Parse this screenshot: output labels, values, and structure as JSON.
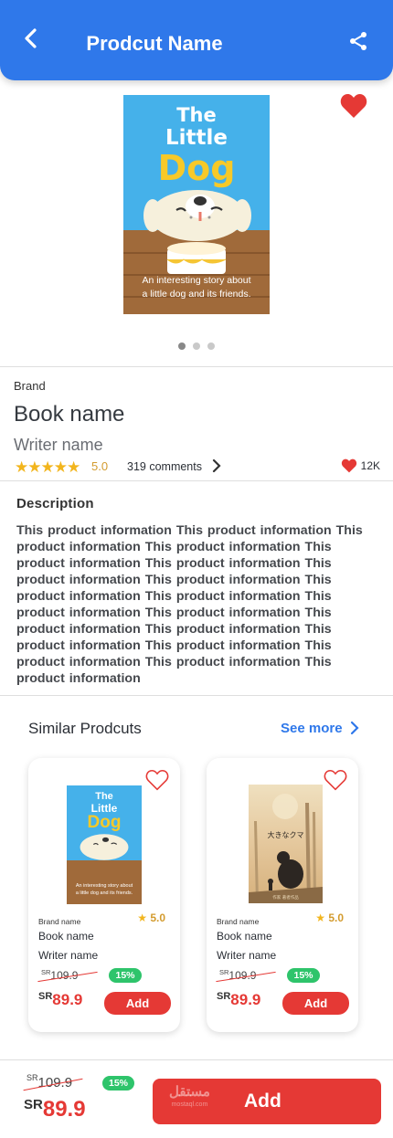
{
  "header": {
    "title": "Prodcut Name",
    "back_icon": "chevron-left-icon",
    "share_icon": "share-icon",
    "background": "#2f78ea"
  },
  "hero": {
    "cover": {
      "title_line1": "The",
      "title_line2": "Little",
      "title_line3": "Dog",
      "blurb_line1": "An interesting story about",
      "blurb_line2": "a little dog and its friends."
    },
    "favorite_icon": "heart-filled-icon",
    "carousel_dots": 3,
    "active_dot": 1
  },
  "product": {
    "brand": "Brand",
    "book_name": "Book name",
    "writer_name": "Writer name",
    "rating": "5.0",
    "stars": 5,
    "comments": "319 comments",
    "likes": "12K"
  },
  "description": {
    "title": "Description",
    "text": "This product information This product information This product information This product information This product information This product information This product information This product information This product information This product information This product information This product information This product information This product information This product information This product information This product information This product information This product information"
  },
  "similar": {
    "title": "Similar Prodcuts",
    "see_more": "See more",
    "items": [
      {
        "cover": "dog-cover",
        "cover_title_line1": "The",
        "cover_title_line2": "Little",
        "cover_title_line3": "Dog",
        "cover_blurb_line1": "An interesting story about",
        "cover_blurb_line2": "a little dog and its friends.",
        "brand": "Brand name",
        "rating": "5.0",
        "name": "Book name",
        "writer": "Writer name",
        "old_currency": "SR",
        "old_price": "109.9",
        "discount": "15%",
        "currency": "SR",
        "price": "89.9",
        "add_label": "Add"
      },
      {
        "cover": "bear-cover",
        "cover_title": "大きなクマ",
        "cover_author": "作家 著者作品",
        "brand": "Brand name",
        "rating": "5.0",
        "name": "Book name",
        "writer": "Writer name",
        "old_currency": "SR",
        "old_price": "109.9",
        "discount": "15%",
        "currency": "SR",
        "price": "89.9",
        "add_label": "Add"
      }
    ]
  },
  "bottom_bar": {
    "old_currency": "SR",
    "old_price": "109.9",
    "discount": "15%",
    "currency": "SR",
    "price": "89.9",
    "add_label": "Add",
    "watermark": "مستقل",
    "watermark_sub": "mostaql.com"
  },
  "colors": {
    "primary": "#2f78ea",
    "accent_red": "#e53935",
    "discount_green": "#2ec46b",
    "star": "#f2b51d"
  }
}
